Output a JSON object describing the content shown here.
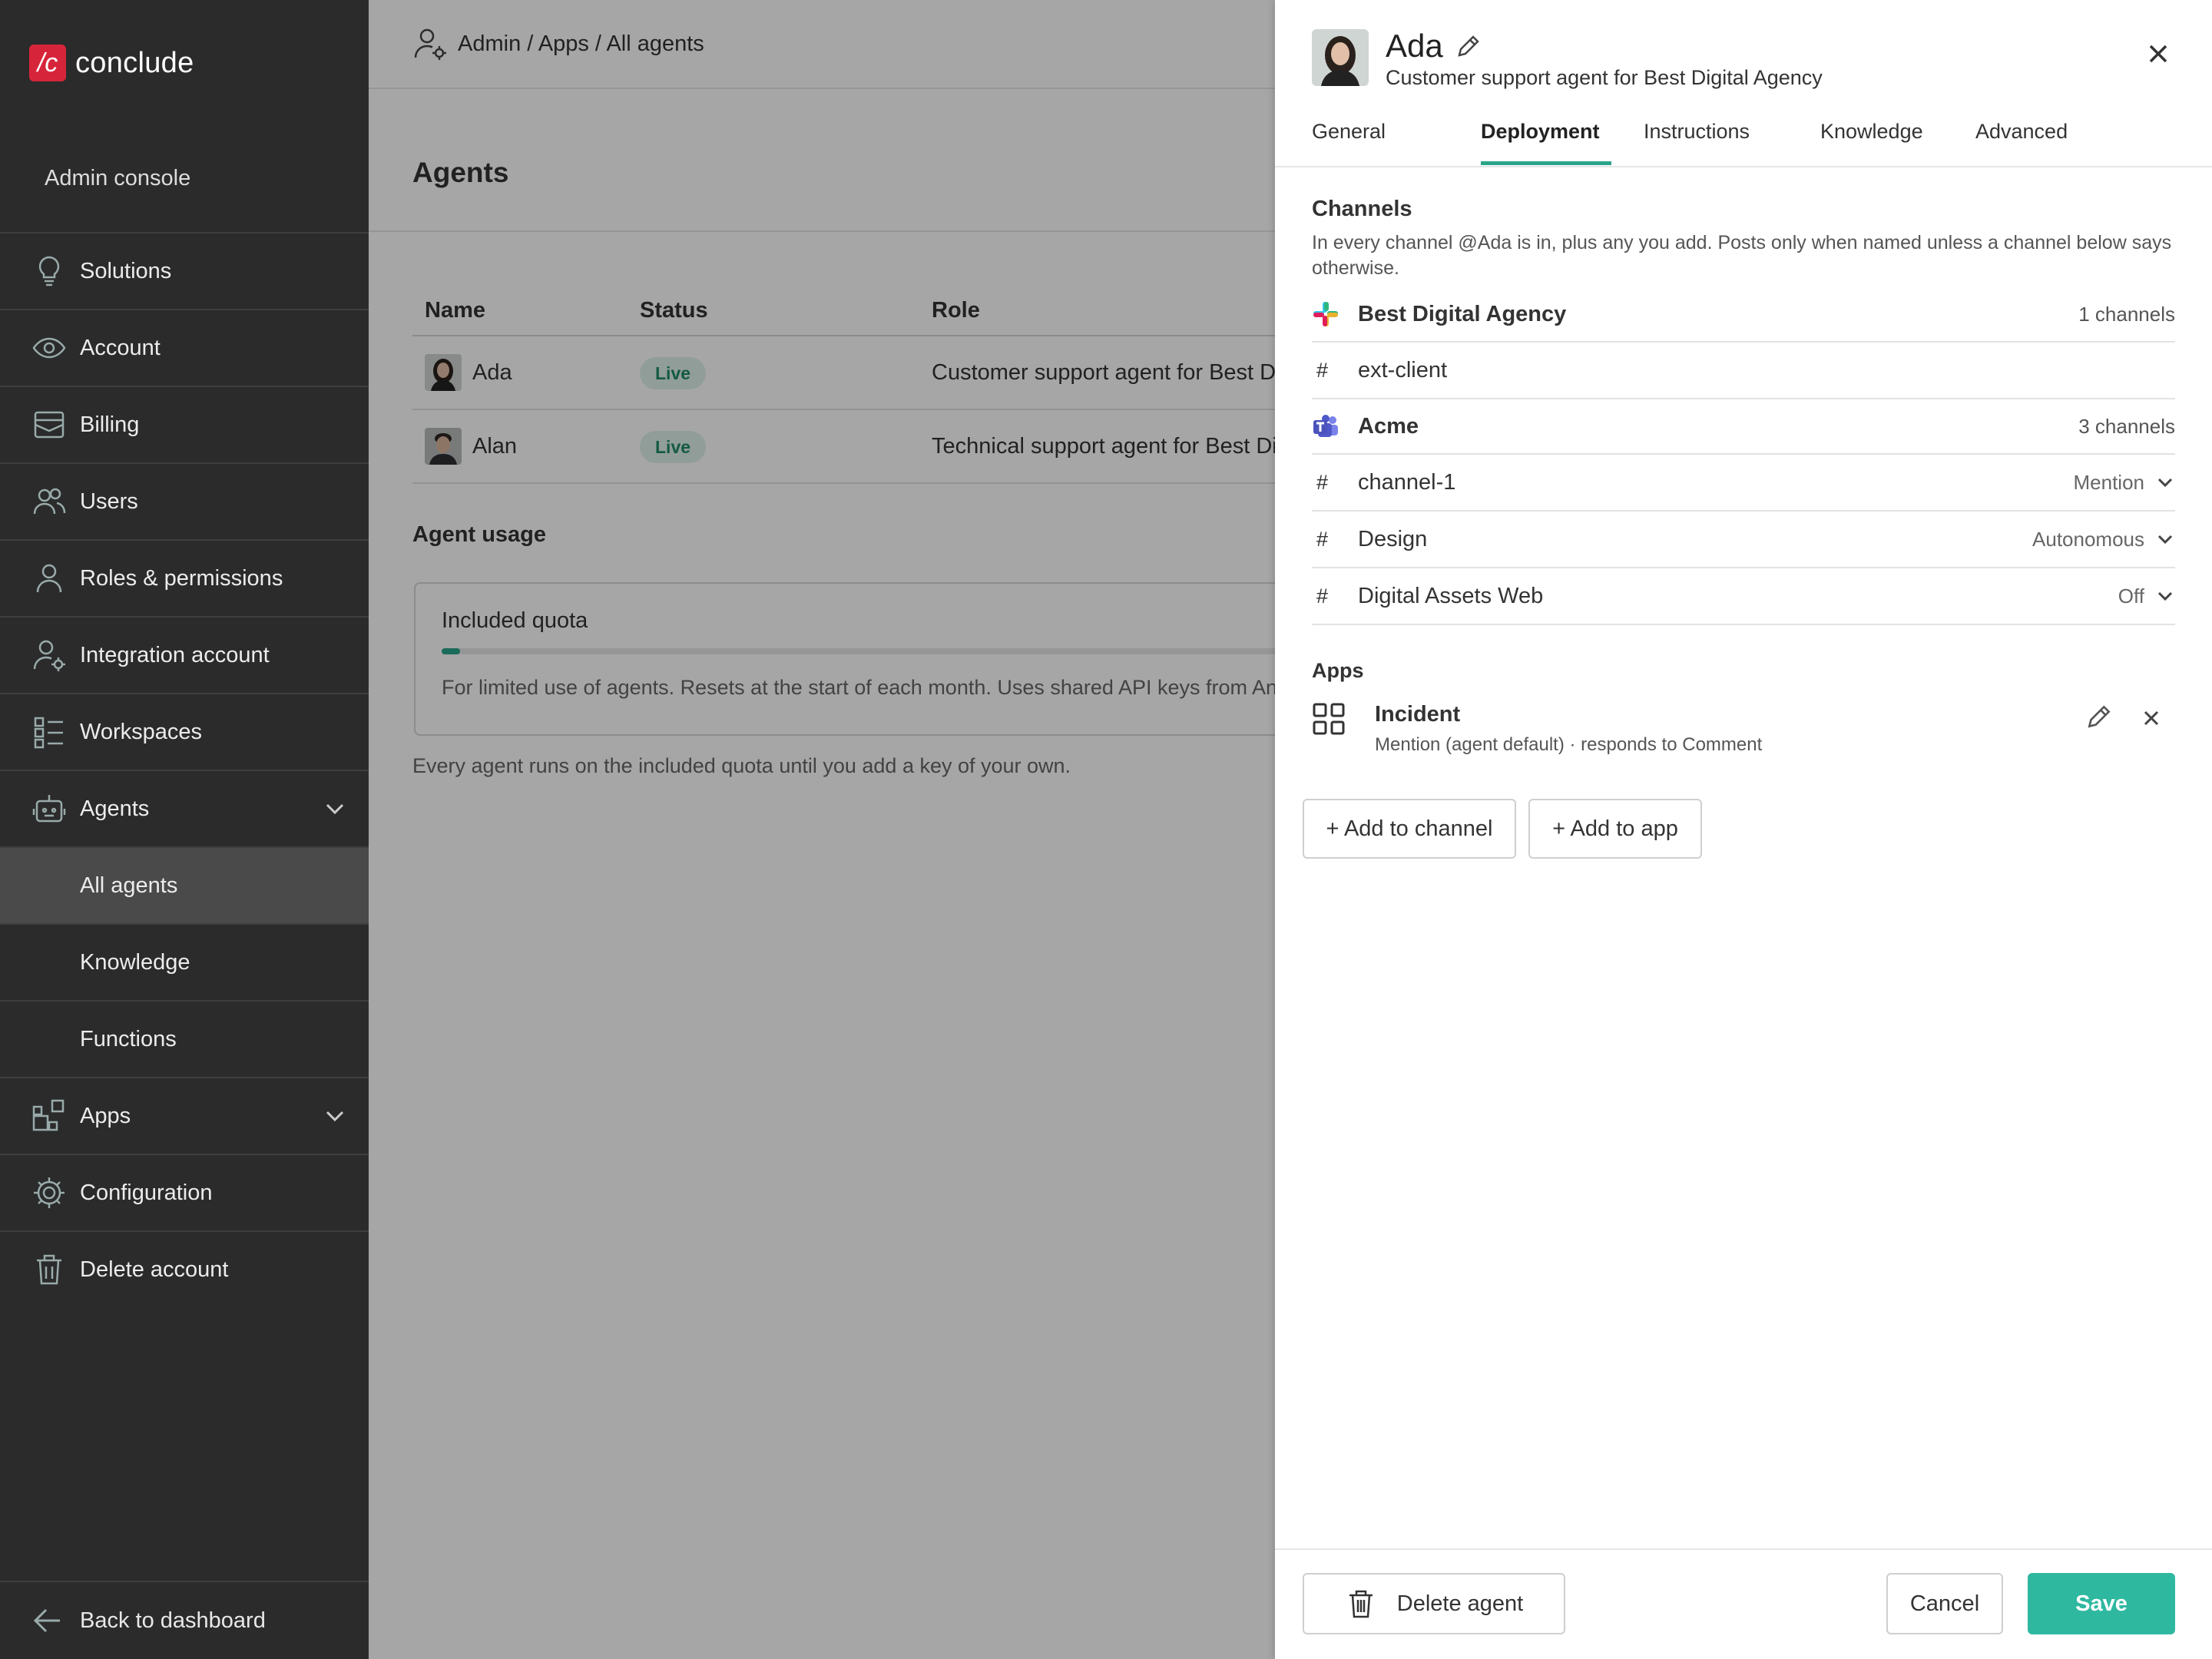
{
  "brand": {
    "logo_mark": "/c",
    "name": "conclude",
    "accent": "#d6253a"
  },
  "sidebar": {
    "console_title": "Admin console",
    "items": [
      {
        "label": "Solutions",
        "icon": "lightbulb-icon"
      },
      {
        "label": "Account",
        "icon": "eye-icon"
      },
      {
        "label": "Billing",
        "icon": "billing-icon"
      },
      {
        "label": "Users",
        "icon": "users-icon"
      },
      {
        "label": "Roles & permissions",
        "icon": "person-icon"
      },
      {
        "label": "Integration account",
        "icon": "person-gear-icon"
      },
      {
        "label": "Workspaces",
        "icon": "workspaces-icon"
      },
      {
        "label": "Agents",
        "icon": "robot-icon",
        "expanded": true
      },
      {
        "label": "All agents",
        "active": true
      },
      {
        "label": "Knowledge"
      },
      {
        "label": "Functions"
      },
      {
        "label": "Apps",
        "icon": "apps-icon",
        "expanded": false
      },
      {
        "label": "Configuration",
        "icon": "gear-icon"
      },
      {
        "label": "Delete account",
        "icon": "trash-icon"
      }
    ],
    "back_label": "Back to dashboard"
  },
  "breadcrumb": "Admin / Apps / All agents",
  "page": {
    "title": "Agents",
    "table": {
      "headers": [
        "Name",
        "Status",
        "Role"
      ],
      "rows": [
        {
          "name": "Ada",
          "status": "Live",
          "role": "Customer support agent for Best Dig"
        },
        {
          "name": "Alan",
          "status": "Live",
          "role": "Technical support agent for Best Digi"
        }
      ]
    },
    "usage_title": "Agent usage",
    "quota": {
      "title": "Included quota",
      "progress_fraction": 0.015,
      "description": "For limited use of agents. Resets at the start of each month. Uses shared API keys from Anthropic"
    },
    "usage_note": "Every agent runs on the included quota until you add a key of your own."
  },
  "drawer": {
    "name": "Ada",
    "subtitle": "Customer support agent for Best Digital Agency",
    "tabs": [
      "General",
      "Deployment",
      "Instructions",
      "Knowledge",
      "Advanced"
    ],
    "active_tab": "Deployment",
    "channels_title": "Channels",
    "channels_desc": "In every channel @Ada is in, plus any you add. Posts only when named unless a channel below says otherwise.",
    "workspaces": [
      {
        "name": "Best Digital Agency",
        "icon": "slack-icon",
        "count": "1 channels",
        "channels": [
          {
            "name": "ext-client",
            "mode": ""
          }
        ]
      },
      {
        "name": "Acme",
        "icon": "teams-icon",
        "count": "3 channels",
        "channels": [
          {
            "name": "channel-1",
            "mode": "Mention"
          },
          {
            "name": "Design",
            "mode": "Autonomous"
          },
          {
            "name": "Digital Assets Web",
            "mode": "Off"
          }
        ]
      }
    ],
    "apps_title": "Apps",
    "app": {
      "name": "Incident",
      "desc": "Mention (agent default) · responds to Comment"
    },
    "add_channel_label": "+ Add to channel",
    "add_app_label": "+ Add to app",
    "delete_label": "Delete agent",
    "cancel_label": "Cancel",
    "save_label": "Save",
    "save_color": "#2fb8a0"
  }
}
